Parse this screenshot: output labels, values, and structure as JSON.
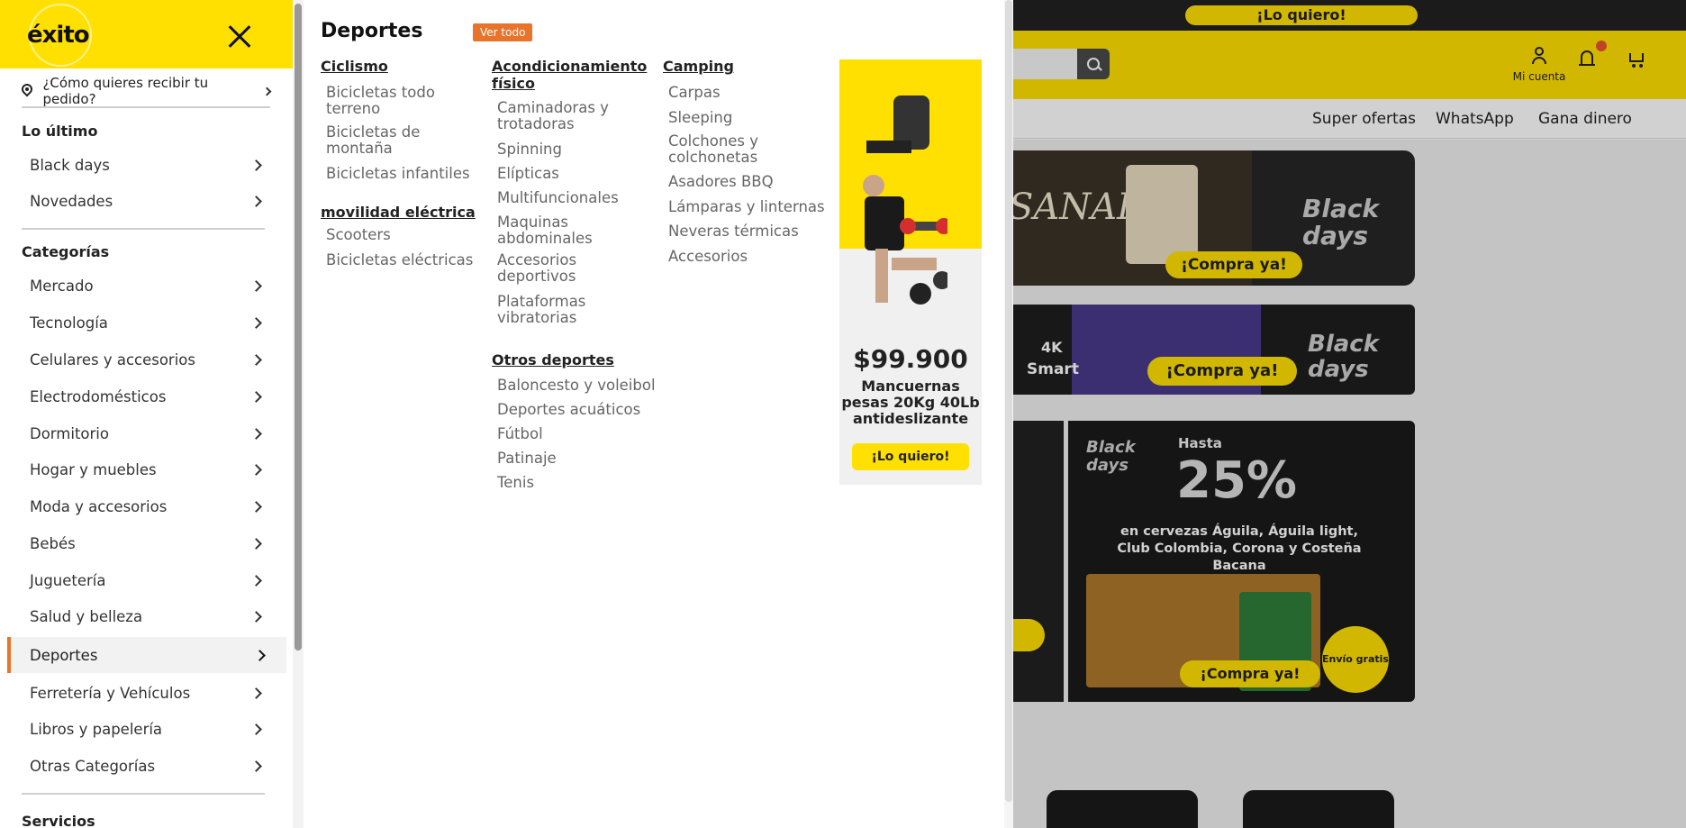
{
  "background": {
    "topbar_cta": "¡Lo quiero!",
    "account_label": "Mi cuenta",
    "nav": [
      "Super ofertas",
      "WhatsApp",
      "Gana dinero"
    ],
    "banners": {
      "b1_text": "SANAL",
      "b1_cta": "¡Compra ya!",
      "b1_badge": "Black days",
      "b2_tag1": "4K",
      "b2_tag2": "Smart",
      "b2_cta": "¡Compra ya!",
      "b2_badge": "Black days",
      "b3_hasta": "Hasta",
      "b3_pct": "25%",
      "b3_desc": "en cervezas Águila, Águila light, Club Colombia, Corona y Costeña Bacana",
      "b3_cta": "¡Compra ya!",
      "b3_badge": "Black days",
      "b3_ship": "Envío gratis"
    }
  },
  "drawer": {
    "logo": "éxito",
    "delivery_label": "¿Cómo quieres recibir tu pedido?",
    "sections": [
      {
        "title": "Lo último",
        "items": [
          "Black days",
          "Novedades"
        ]
      },
      {
        "title": "Categorías",
        "items": [
          "Mercado",
          "Tecnología",
          "Celulares y accesorios",
          "Electrodomésticos",
          "Dormitorio",
          "Hogar y muebles",
          "Moda y accesorios",
          "Bebés",
          "Juguetería",
          "Salud y belleza",
          "Deportes",
          "Ferretería y Vehículos",
          "Libros y papelería",
          "Otras Categorías"
        ]
      },
      {
        "title": "Servicios",
        "items": []
      }
    ],
    "active_item": "Deportes"
  },
  "panel": {
    "title": "Deportes",
    "ver_todo": "Ver todo",
    "columns": [
      {
        "groups": [
          {
            "head": "Ciclismo",
            "links": [
              "Bicicletas todo terreno",
              "Bicicletas de montaña",
              "Bicicletas infantiles"
            ]
          },
          {
            "head": "movilidad eléctrica",
            "links": [
              "Scooters",
              "Bicicletas eléctricas"
            ]
          }
        ]
      },
      {
        "groups": [
          {
            "head": "Acondicionamiento físico",
            "links": [
              "Caminadoras y trotadoras",
              "Spinning",
              "Elípticas",
              "Multifuncionales",
              "Maquinas abdominales",
              "Accesorios deportivos",
              "Plataformas vibratorias"
            ]
          },
          {
            "head": "Otros deportes",
            "links": [
              "Baloncesto y voleibol",
              "Deportes acuáticos",
              "Fútbol",
              "Patinaje",
              "Tenis"
            ]
          }
        ]
      },
      {
        "groups": [
          {
            "head": "Camping",
            "links": [
              "Carpas",
              "Sleeping",
              "Colchones y colchonetas",
              "Asadores BBQ",
              "Lámparas y linternas",
              "Neveras térmicas",
              "Accesorios"
            ]
          }
        ]
      }
    ],
    "promo": {
      "price": "$99.900",
      "desc": "Mancuernas pesas 20Kg 40Lb antideslizante",
      "cta": "¡Lo quiero!"
    }
  }
}
